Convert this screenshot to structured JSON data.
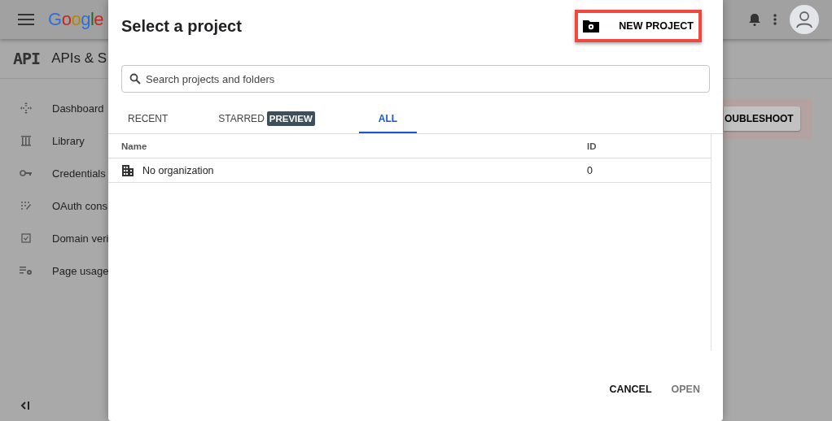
{
  "background": {
    "logo": "Google",
    "api_badge": "API",
    "product_title": "APIs & S",
    "sidebar": [
      {
        "label": "Dashboard"
      },
      {
        "label": "Library"
      },
      {
        "label": "Credentials"
      },
      {
        "label": "OAuth cons"
      },
      {
        "label": "Domain veri"
      },
      {
        "label": "Page usage"
      }
    ],
    "troubleshoot_button": "OUBLESHOOT"
  },
  "dialog": {
    "title": "Select a project",
    "new_project": {
      "label": "NEW PROJECT",
      "highlighted": true
    },
    "search": {
      "placeholder": "Search projects and folders"
    },
    "tabs": [
      {
        "label": "RECENT",
        "selected": false
      },
      {
        "label": "STARRED",
        "badge": "PREVIEW",
        "selected": false
      },
      {
        "label": "ALL",
        "selected": true
      }
    ],
    "table": {
      "columns": [
        "Name",
        "ID"
      ],
      "rows": [
        {
          "name": "No organization",
          "id": "0"
        }
      ]
    },
    "buttons": [
      {
        "label": "CANCEL",
        "disabled": false
      },
      {
        "label": "OPEN",
        "disabled": true
      }
    ]
  }
}
